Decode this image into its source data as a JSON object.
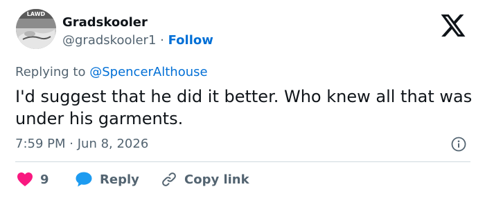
{
  "author": {
    "display_name": "Gradskooler",
    "handle": "@gradskooler1",
    "separator": "·",
    "follow_label": "Follow",
    "avatar_badge": "LAWD"
  },
  "reply_context": {
    "prefix": "Replying to",
    "mention": "@SpencerAlthouse"
  },
  "tweet": {
    "text": "I'd suggest that he did it better. Who knew all that was under his garments."
  },
  "meta": {
    "time": "7:59 PM",
    "separator": "·",
    "date": "Jun 8, 2026"
  },
  "actions": {
    "like_count": "9",
    "reply_label": "Reply",
    "copy_label": "Copy link"
  },
  "colors": {
    "like": "#f91880",
    "reply": "#1d9bf0",
    "link": "#006fd6",
    "muted": "#536471",
    "text": "#0f1419"
  },
  "icons": {
    "brand": "x-logo-icon",
    "info": "info-icon",
    "like": "heart-icon",
    "reply": "speech-bubble-icon",
    "copy": "link-icon"
  }
}
